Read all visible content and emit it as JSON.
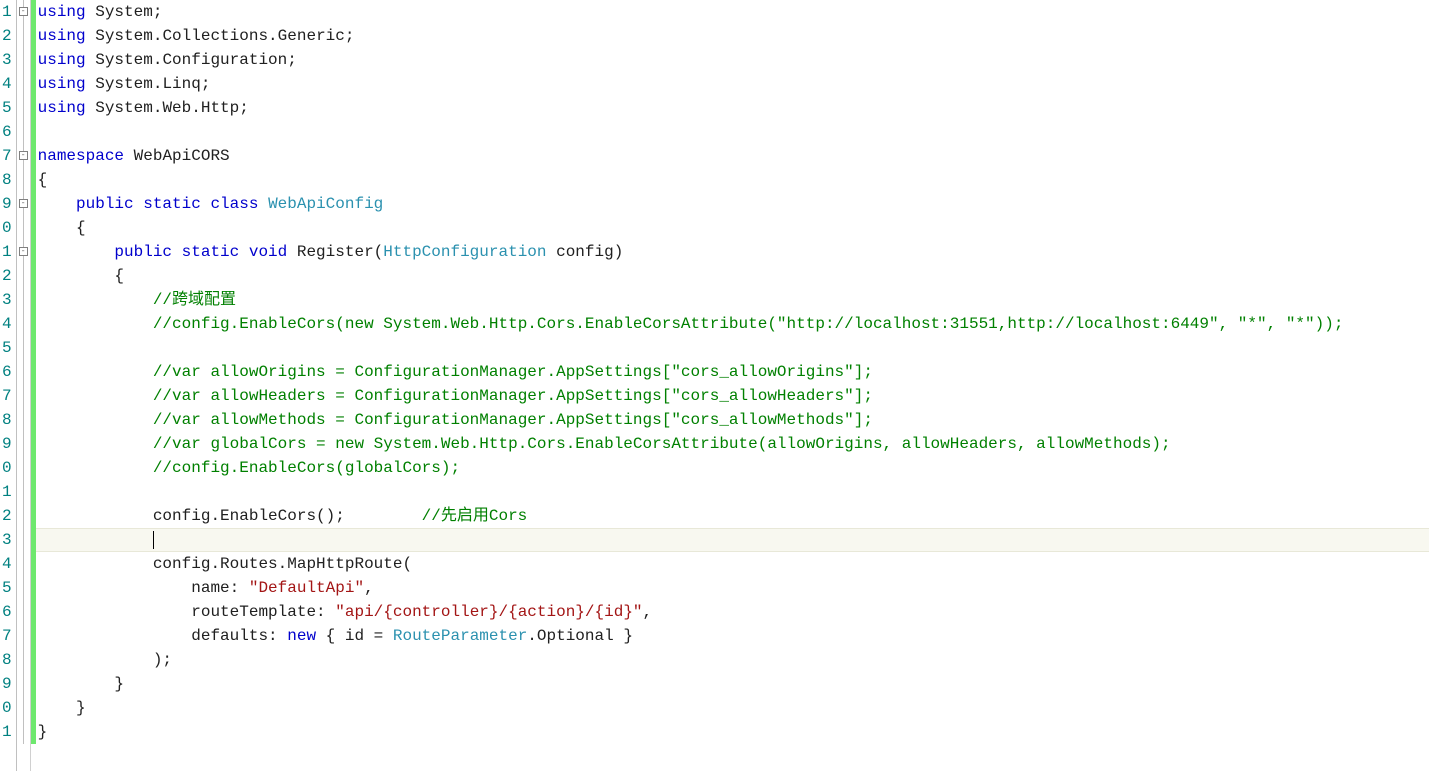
{
  "lineNumbers": [
    "1",
    "2",
    "3",
    "4",
    "5",
    "6",
    "7",
    "8",
    "9",
    "0",
    "1",
    "2",
    "3",
    "4",
    "5",
    "6",
    "7",
    "8",
    "9",
    "0",
    "1",
    "2",
    "3",
    "4",
    "5",
    "6",
    "7",
    "8",
    "9",
    "0",
    "1"
  ],
  "foldMarks": [
    0,
    6,
    8,
    10
  ],
  "changedLines": [
    0,
    1,
    2,
    3,
    4,
    5,
    6,
    7,
    8,
    9,
    10,
    11,
    12,
    13,
    14,
    15,
    16,
    17,
    18,
    19,
    20,
    21,
    22,
    23,
    24,
    25,
    26,
    27,
    28,
    29,
    30
  ],
  "currentLine": 22,
  "code": [
    [
      [
        "kw",
        "using"
      ],
      [
        "pln",
        " System;"
      ]
    ],
    [
      [
        "kw",
        "using"
      ],
      [
        "pln",
        " System.Collections.Generic;"
      ]
    ],
    [
      [
        "kw",
        "using"
      ],
      [
        "pln",
        " System.Configuration;"
      ]
    ],
    [
      [
        "kw",
        "using"
      ],
      [
        "pln",
        " System.Linq;"
      ]
    ],
    [
      [
        "kw",
        "using"
      ],
      [
        "pln",
        " System.Web.Http;"
      ]
    ],
    [
      [
        "pln",
        ""
      ]
    ],
    [
      [
        "kw",
        "namespace"
      ],
      [
        "pln",
        " WebApiCORS"
      ]
    ],
    [
      [
        "pln",
        "{"
      ]
    ],
    [
      [
        "pln",
        "    "
      ],
      [
        "kw",
        "public static class"
      ],
      [
        "pln",
        " "
      ],
      [
        "type",
        "WebApiConfig"
      ]
    ],
    [
      [
        "pln",
        "    {"
      ]
    ],
    [
      [
        "pln",
        "        "
      ],
      [
        "kw",
        "public static void"
      ],
      [
        "pln",
        " Register("
      ],
      [
        "type",
        "HttpConfiguration"
      ],
      [
        "pln",
        " config)"
      ]
    ],
    [
      [
        "pln",
        "        {"
      ]
    ],
    [
      [
        "pln",
        "            "
      ],
      [
        "com",
        "//跨域配置"
      ]
    ],
    [
      [
        "pln",
        "            "
      ],
      [
        "com",
        "//config.EnableCors(new System.Web.Http.Cors.EnableCorsAttribute(\"http://localhost:31551,http://localhost:6449\", \"*\", \"*\"));"
      ]
    ],
    [
      [
        "pln",
        ""
      ]
    ],
    [
      [
        "pln",
        "            "
      ],
      [
        "com",
        "//var allowOrigins = ConfigurationManager.AppSettings[\"cors_allowOrigins\"];"
      ]
    ],
    [
      [
        "pln",
        "            "
      ],
      [
        "com",
        "//var allowHeaders = ConfigurationManager.AppSettings[\"cors_allowHeaders\"];"
      ]
    ],
    [
      [
        "pln",
        "            "
      ],
      [
        "com",
        "//var allowMethods = ConfigurationManager.AppSettings[\"cors_allowMethods\"];"
      ]
    ],
    [
      [
        "pln",
        "            "
      ],
      [
        "com",
        "//var globalCors = new System.Web.Http.Cors.EnableCorsAttribute(allowOrigins, allowHeaders, allowMethods);"
      ]
    ],
    [
      [
        "pln",
        "            "
      ],
      [
        "com",
        "//config.EnableCors(globalCors);"
      ]
    ],
    [
      [
        "pln",
        ""
      ]
    ],
    [
      [
        "pln",
        "            config.EnableCors();        "
      ],
      [
        "com",
        "//先启用Cors"
      ]
    ],
    [
      [
        "pln",
        "            "
      ]
    ],
    [
      [
        "pln",
        "            config.Routes.MapHttpRoute("
      ]
    ],
    [
      [
        "pln",
        "                name: "
      ],
      [
        "str",
        "\"DefaultApi\""
      ],
      [
        "pln",
        ","
      ]
    ],
    [
      [
        "pln",
        "                routeTemplate: "
      ],
      [
        "str",
        "\"api/{controller}/{action}/{id}\""
      ],
      [
        "pln",
        ","
      ]
    ],
    [
      [
        "pln",
        "                defaults: "
      ],
      [
        "kw",
        "new"
      ],
      [
        "pln",
        " { id = "
      ],
      [
        "type",
        "RouteParameter"
      ],
      [
        "pln",
        ".Optional }"
      ]
    ],
    [
      [
        "pln",
        "            );"
      ]
    ],
    [
      [
        "pln",
        "        }"
      ]
    ],
    [
      [
        "pln",
        "    }"
      ]
    ],
    [
      [
        "pln",
        "}"
      ]
    ]
  ]
}
